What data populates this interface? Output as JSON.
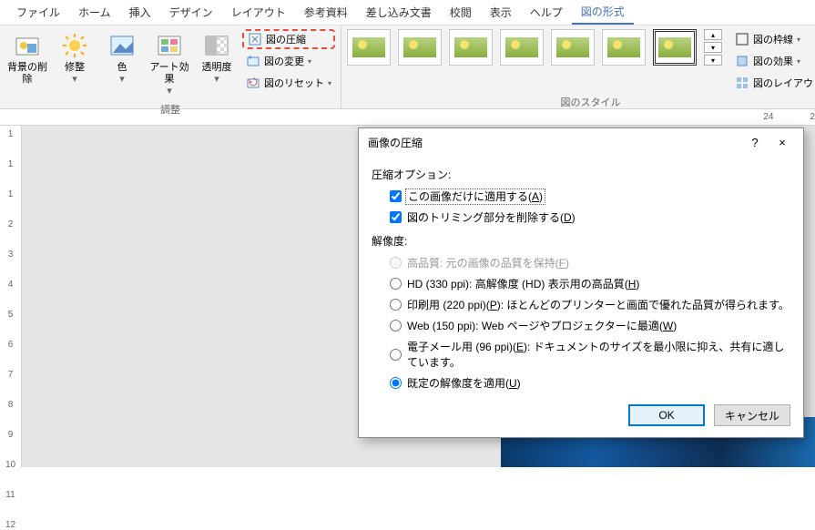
{
  "tabs": [
    "ファイル",
    "ホーム",
    "挿入",
    "デザイン",
    "レイアウト",
    "参考資料",
    "差し込み文書",
    "校閲",
    "表示",
    "ヘルプ",
    "図の形式"
  ],
  "active_tab_index": 10,
  "ribbon": {
    "adjust": {
      "label": "調整",
      "remove_bg": "背景の削除",
      "corrections": "修整",
      "color": "色",
      "artistic": "アート効果",
      "transparency": "透明度",
      "compress": "図の圧縮",
      "change": "図の変更",
      "reset": "図のリセット"
    },
    "styles": {
      "label": "図のスタイル",
      "border": "図の枠線",
      "effects": "図の効果",
      "layout": "図のレイアウト"
    }
  },
  "ruler_h": [
    "24",
    "2"
  ],
  "ruler_v": [
    "1",
    "1",
    "1",
    "2",
    "3",
    "4",
    "5",
    "6",
    "7",
    "8",
    "9",
    "10",
    "11",
    "12"
  ],
  "dialog": {
    "title": "画像の圧縮",
    "help": "?",
    "close": "×",
    "compression_options": "圧縮オプション:",
    "apply_only": {
      "pre": "この画像だけに適用する(",
      "accel": "A",
      "post": ")"
    },
    "delete_crop": {
      "pre": "図のトリミング部分を削除する(",
      "accel": "D",
      "post": ")"
    },
    "resolution": "解像度:",
    "res_high": {
      "pre": "高品質: 元の画像の品質を保持(",
      "accel": "F",
      "post": ")"
    },
    "res_hd": {
      "pre": "HD (330 ppi): 高解像度 (HD) 表示用の高品質(",
      "accel": "H",
      "post": ")"
    },
    "res_print": {
      "pre": "印刷用 (220 ppi)(",
      "accel": "P",
      "post": "): ほとんどのプリンターと画面で優れた品質が得られます。"
    },
    "res_web": {
      "pre": "Web (150 ppi): Web ページやプロジェクターに最適(",
      "accel": "W",
      "post": ")"
    },
    "res_email": {
      "pre": "電子メール用 (96 ppi)(",
      "accel": "E",
      "post": "): ドキュメントのサイズを最小限に抑え、共有に適しています。"
    },
    "res_default": {
      "pre": "既定の解像度を適用(",
      "accel": "U",
      "post": ")"
    },
    "ok": "OK",
    "cancel": "キャンセル"
  }
}
